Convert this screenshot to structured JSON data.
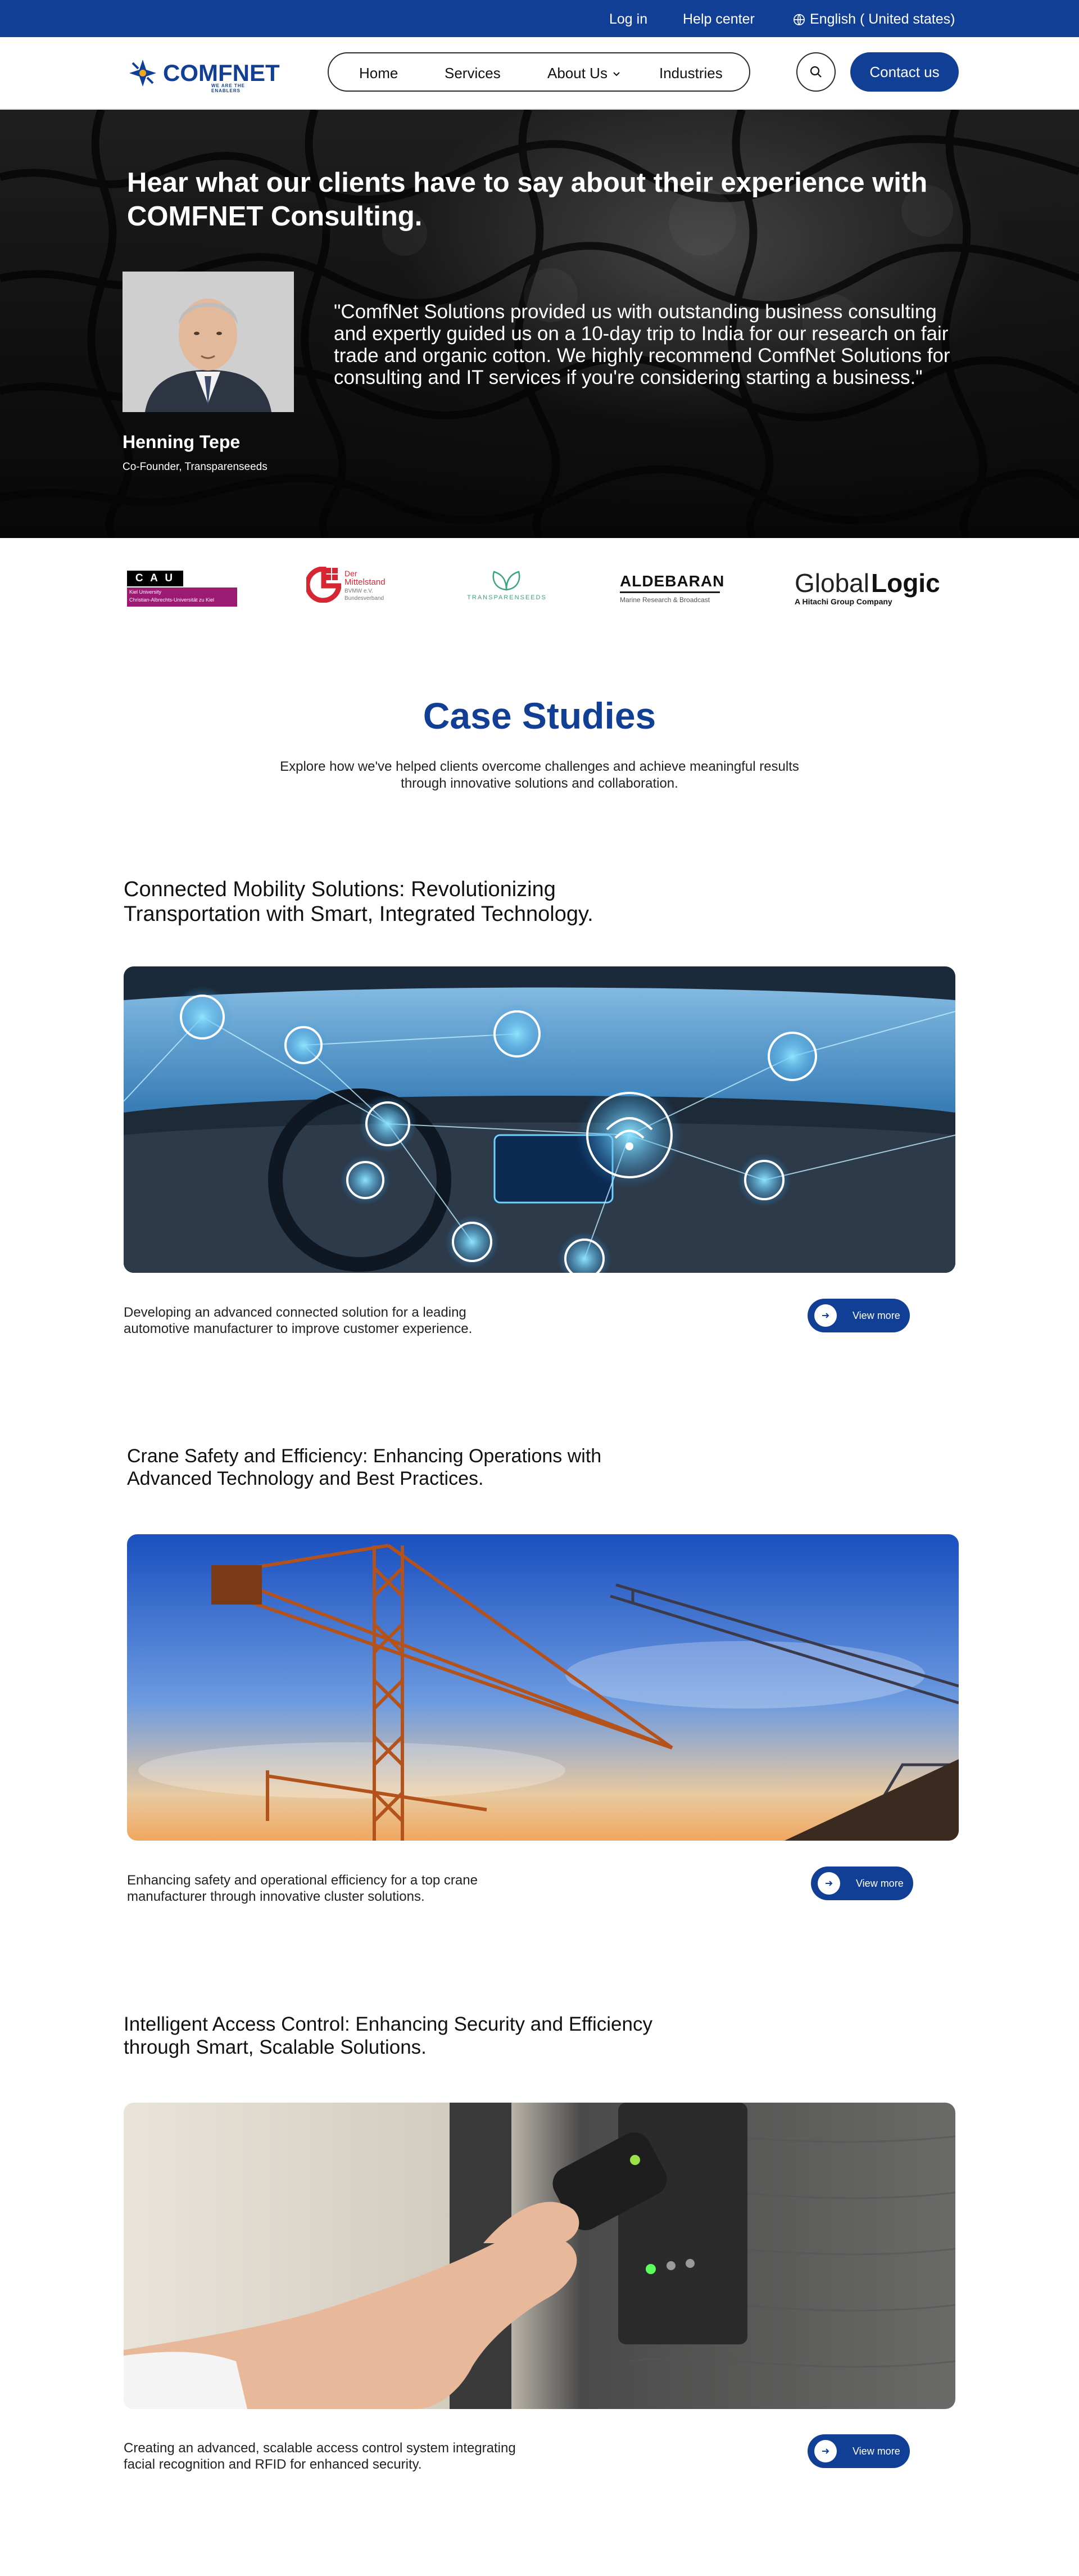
{
  "topbar": {
    "login": "Log in",
    "help": "Help center",
    "language": "English ( United states)",
    "icon": "globe-icon"
  },
  "header": {
    "logo_text": "COMFNET",
    "logo_tagline": "WE ARE THE ENABLERS",
    "nav": [
      "Home",
      "Services",
      "About Us",
      "Industries"
    ],
    "search_icon": "search-icon",
    "contact_label": "Contact us"
  },
  "hero": {
    "title": "Hear what our clients have to say about their experience with COMFNET Consulting.",
    "quote": "\"ComfNet Solutions provided us with outstanding business consulting and expertly guided us on a 10-day trip to India for our research on fair trade and organic cotton. We highly recommend ComfNet Solutions for consulting and IT services if you're considering starting a business.\"",
    "name": "Henning Tepe",
    "role": "Co-Founder, Transparenseeds"
  },
  "partners": {
    "cau_letters": "C A U",
    "cau_text1": "Kiel University",
    "cau_text2": "Christian-Albrechts-Universität zu Kiel",
    "mittelstand_1": "Der",
    "mittelstand_2": "Mittelstand",
    "mittelstand_3": "BVMW e.V.",
    "mittelstand_4": "Bundesverband",
    "transparenseeds": "TRANSPARENSEEDS",
    "aldebaran": "ALDEBARAN",
    "aldebaran_sub": "Marine Research & Broadcast",
    "globallogic_1": "Global",
    "globallogic_2": "Logic",
    "globallogic_sub": "A Hitachi Group Company"
  },
  "case_studies": {
    "title": "Case Studies",
    "subtitle": "Explore how we've helped clients overcome challenges and achieve meaningful results through innovative solutions and collaboration.",
    "view_more": "View more",
    "items": [
      {
        "title_1": "Connected Mobility Solutions: Revolutionizing",
        "title_2": "Transportation with Smart, Integrated Technology.",
        "desc": "Developing an advanced connected solution for a leading automotive manufacturer to improve customer experience."
      },
      {
        "title_1": "Crane Safety and Efficiency: Enhancing Operations with",
        "title_2": "Advanced Technology and Best Practices.",
        "desc": "Enhancing safety and operational efficiency for a top crane manufacturer through innovative cluster solutions."
      },
      {
        "title_1": "Intelligent Access Control: Enhancing Security and Efficiency",
        "title_2": "through Smart, Scalable Solutions.",
        "desc": "Creating an advanced, scalable access control system integrating facial recognition and RFID for enhanced security."
      }
    ]
  },
  "colors": {
    "brand_blue": "#123f96",
    "white": "#ffffff"
  }
}
